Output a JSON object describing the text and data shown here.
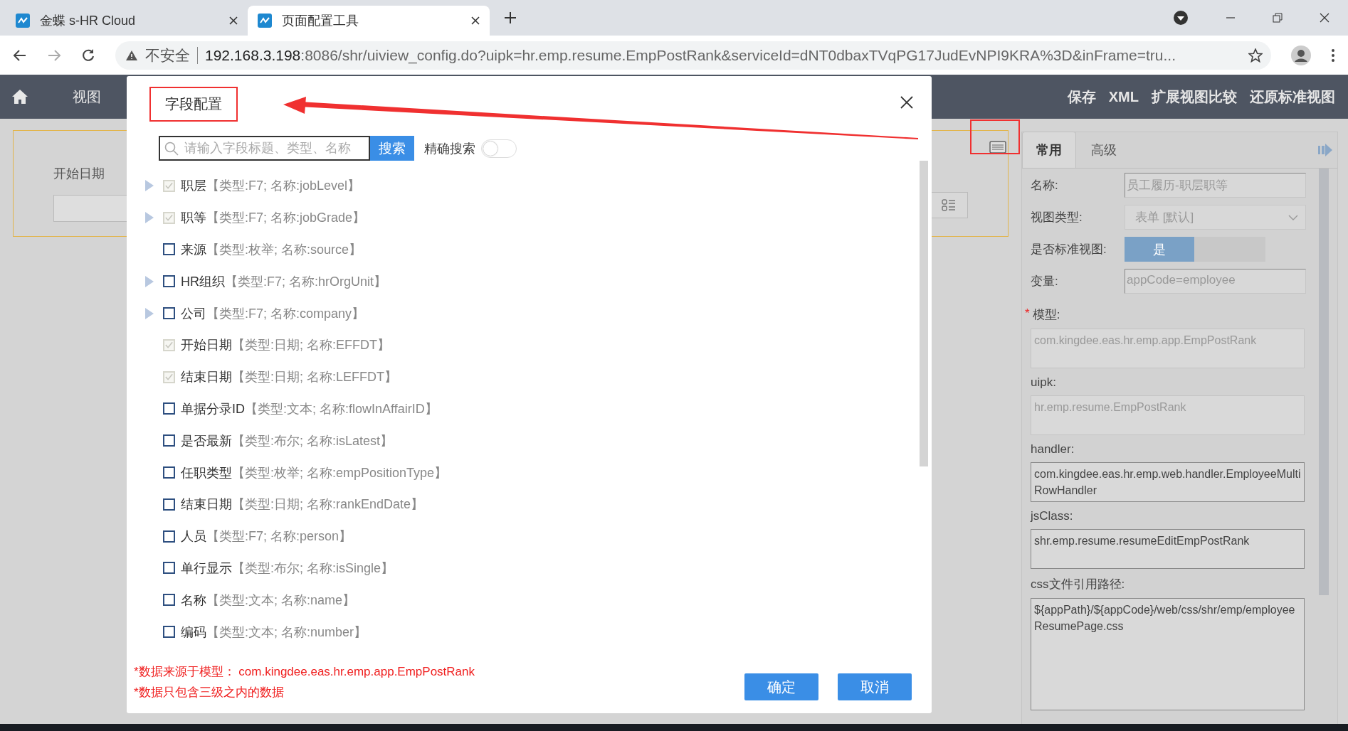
{
  "browser": {
    "tabs": [
      {
        "title": "金蝶 s-HR Cloud",
        "selected": false
      },
      {
        "title": "页面配置工具",
        "selected": true
      }
    ],
    "address": {
      "security": "不安全",
      "host": "192.168.3.198",
      "path": ":8086/shr/uiview_config.do?uipk=hr.emp.resume.EmpPostRank&serviceId=dNT0dbaxTVqPG17JudEvNPI9KRA%3D&inFrame=tru..."
    }
  },
  "app": {
    "breadcrumb": "视图",
    "actions": [
      "保存",
      "XML",
      "扩展视图比较",
      "还原标准视图"
    ]
  },
  "canvas": {
    "field_label": "开始日期"
  },
  "properties": {
    "tabs": [
      {
        "label": "常用",
        "selected": true
      },
      {
        "label": "高级",
        "selected": false
      }
    ],
    "fields": [
      {
        "kind": "input",
        "label": "名称:",
        "value": "员工履历-职层职等",
        "disabled": true
      },
      {
        "kind": "select",
        "label": "视图类型:",
        "value": "表单 [默认]",
        "disabled": true
      },
      {
        "kind": "toggle",
        "label": "是否标准视图:",
        "value": "是",
        "on": true,
        "disabled": false
      },
      {
        "kind": "input",
        "label": "变量:",
        "value": "appCode=employee",
        "disabled": true
      },
      {
        "kind": "textarea",
        "required_mark": "*",
        "label": "模型:",
        "value": "com.kingdee.eas.hr.emp.app.EmpPostRank",
        "disabled": true
      },
      {
        "kind": "textarea",
        "label": "uipk:",
        "value": "hr.emp.resume.EmpPostRank",
        "disabled": true
      },
      {
        "kind": "textarea",
        "label": "handler:",
        "value": "com.kingdee.eas.hr.emp.web.handler.EmployeeMultiRowHandler",
        "disabled": false
      },
      {
        "kind": "textarea",
        "label": "jsClass:",
        "value": "shr.emp.resume.resumeEditEmpPostRank",
        "disabled": false
      },
      {
        "kind": "tall",
        "label": "css文件引用路径:",
        "value": "${appPath}/${appCode}/web/css/shr/emp/employeeResumePage.css",
        "disabled": false
      }
    ]
  },
  "dialog": {
    "title": "字段配置",
    "search": {
      "placeholder": "请输入字段标题、类型、名称",
      "button": "搜索"
    },
    "exact_search": {
      "label": "精确搜索",
      "on": false
    },
    "items": [
      {
        "label": "职层",
        "meta": "【类型:F7; 名称:jobLevel】",
        "checked": true,
        "disabled": true,
        "has_children": true
      },
      {
        "label": "职等",
        "meta": "【类型:F7; 名称:jobGrade】",
        "checked": true,
        "disabled": true,
        "has_children": true
      },
      {
        "label": "来源",
        "meta": "【类型:枚举; 名称:source】",
        "checked": false,
        "disabled": false,
        "has_children": false
      },
      {
        "label": "HR组织",
        "meta": "【类型:F7; 名称:hrOrgUnit】",
        "checked": false,
        "disabled": false,
        "has_children": true
      },
      {
        "label": "公司",
        "meta": "【类型:F7; 名称:company】",
        "checked": false,
        "disabled": false,
        "has_children": true
      },
      {
        "label": "开始日期",
        "meta": "【类型:日期; 名称:EFFDT】",
        "checked": true,
        "disabled": true,
        "has_children": false
      },
      {
        "label": "结束日期",
        "meta": "【类型:日期; 名称:LEFFDT】",
        "checked": true,
        "disabled": true,
        "has_children": false
      },
      {
        "label": "单据分录ID",
        "meta": "【类型:文本; 名称:flowInAffairID】",
        "checked": false,
        "disabled": false,
        "has_children": false
      },
      {
        "label": "是否最新",
        "meta": "【类型:布尔; 名称:isLatest】",
        "checked": false,
        "disabled": false,
        "has_children": false
      },
      {
        "label": "任职类型",
        "meta": "【类型:枚举; 名称:empPositionType】",
        "checked": false,
        "disabled": false,
        "has_children": false
      },
      {
        "label": "结束日期",
        "meta": "【类型:日期; 名称:rankEndDate】",
        "checked": false,
        "disabled": false,
        "has_children": false
      },
      {
        "label": "人员",
        "meta": "【类型:F7; 名称:person】",
        "checked": false,
        "disabled": false,
        "has_children": false
      },
      {
        "label": "单行显示",
        "meta": "【类型:布尔; 名称:isSingle】",
        "checked": false,
        "disabled": false,
        "has_children": false
      },
      {
        "label": "名称",
        "meta": "【类型:文本; 名称:name】",
        "checked": false,
        "disabled": false,
        "has_children": false
      },
      {
        "label": "编码",
        "meta": "【类型:文本; 名称:number】",
        "checked": false,
        "disabled": false,
        "has_children": false
      }
    ],
    "notes": [
      "*数据来源于模型： com.kingdee.eas.hr.emp.app.EmpPostRank",
      "*数据只包含三级之内的数据"
    ],
    "buttons": [
      "确定",
      "取消"
    ]
  }
}
